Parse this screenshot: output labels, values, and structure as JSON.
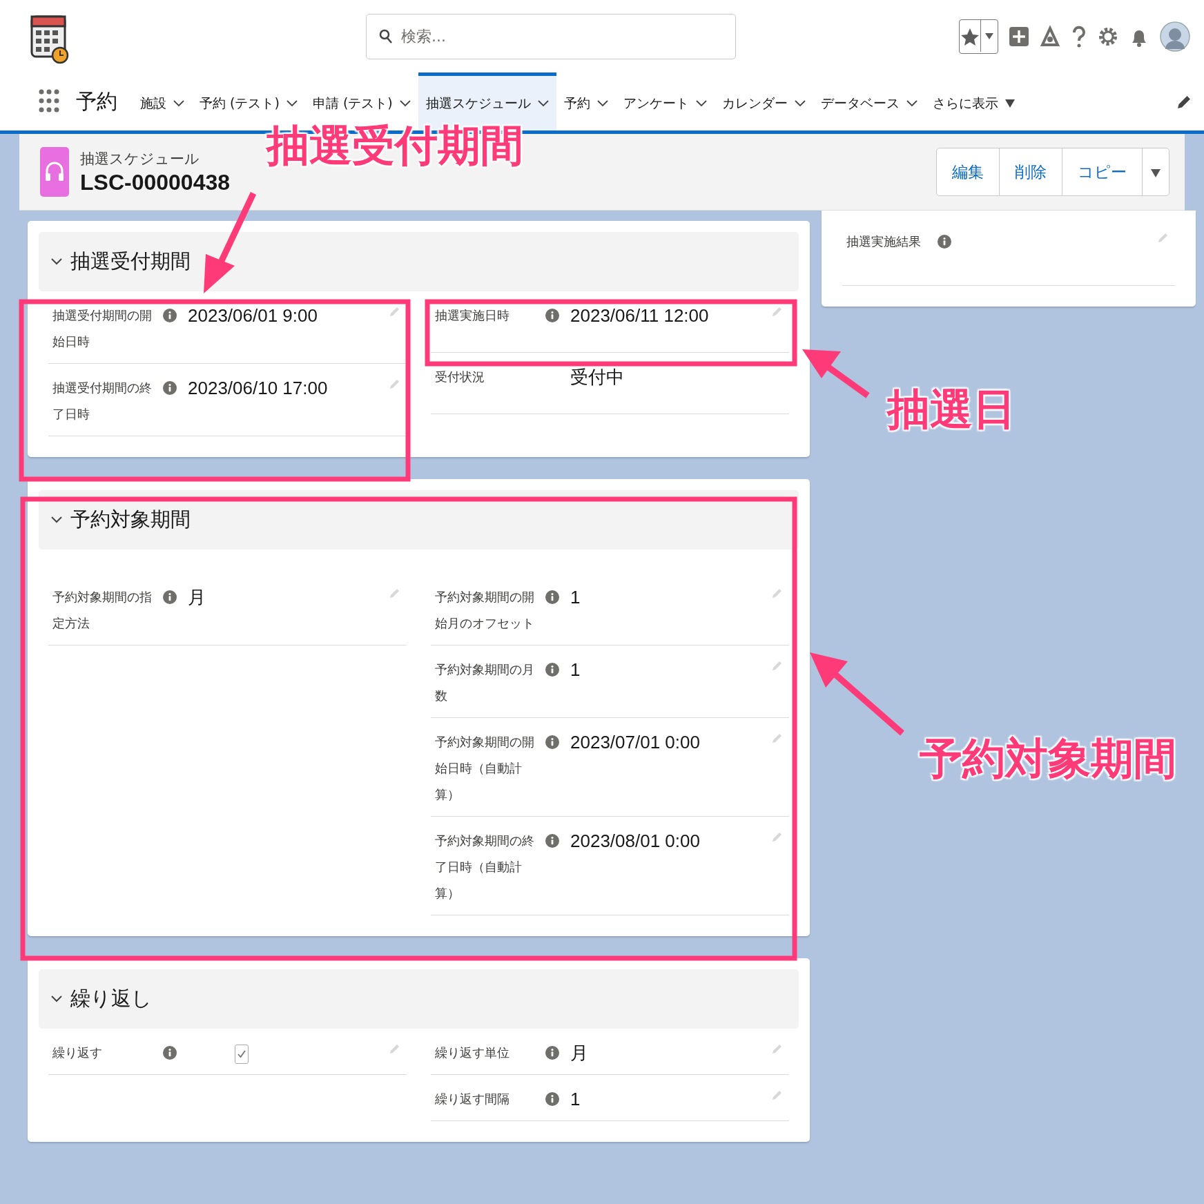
{
  "search": {
    "placeholder": "検索..."
  },
  "app": {
    "name": "予約"
  },
  "nav_tabs": [
    {
      "label": "施設",
      "selected": false,
      "kind": "menu"
    },
    {
      "label": "予約 (テスト)",
      "selected": false,
      "kind": "menu"
    },
    {
      "label": "申請 (テスト)",
      "selected": false,
      "kind": "menu"
    },
    {
      "label": "抽選スケジュール",
      "selected": true,
      "kind": "menu"
    },
    {
      "label": "予約",
      "selected": false,
      "kind": "menu"
    },
    {
      "label": "アンケート",
      "selected": false,
      "kind": "menu"
    },
    {
      "label": "カレンダー",
      "selected": false,
      "kind": "menu"
    },
    {
      "label": "データベース",
      "selected": false,
      "kind": "menu"
    },
    {
      "label": "さらに表示",
      "selected": false,
      "kind": "more"
    }
  ],
  "record": {
    "object_label": "抽選スケジュール",
    "name": "LSC-00000438",
    "actions": [
      "編集",
      "削除",
      "コピー"
    ]
  },
  "sections": [
    {
      "title": "抽選受付期間",
      "expanded": true,
      "left_fields": [
        {
          "label": "抽選受付期間の開始日時",
          "info": true,
          "kind": "text",
          "value": "2023/06/01 9:00",
          "editable": true
        },
        {
          "label": "抽選受付期間の終了日時",
          "info": true,
          "kind": "text",
          "value": "2023/06/10 17:00",
          "editable": true
        }
      ],
      "right_fields": [
        {
          "label": "抽選実施日時",
          "info": true,
          "kind": "text",
          "value": "2023/06/11 12:00",
          "editable": true
        },
        {
          "label": "受付状況",
          "info": false,
          "kind": "text",
          "value": "受付中",
          "editable": false
        }
      ]
    },
    {
      "title": "予約対象期間",
      "expanded": true,
      "left_fields": [
        {
          "label": "予約対象期間の指定方法",
          "info": true,
          "kind": "text",
          "value": "月",
          "editable": true
        }
      ],
      "right_fields": [
        {
          "label": "予約対象期間の開始月のオフセット",
          "info": true,
          "kind": "text",
          "value": "1",
          "editable": true
        },
        {
          "label": "予約対象期間の月数",
          "info": true,
          "kind": "text",
          "value": "1",
          "editable": true
        },
        {
          "label": "予約対象期間の開始日時（自動計算）",
          "info": true,
          "kind": "text",
          "value": "2023/07/01 0:00",
          "editable": true
        },
        {
          "label": "予約対象期間の終了日時（自動計算）",
          "info": true,
          "kind": "text",
          "value": "2023/08/01 0:00",
          "editable": true
        }
      ]
    },
    {
      "title": "繰り返し",
      "expanded": true,
      "left_fields": [
        {
          "label": "繰り返す",
          "info": true,
          "kind": "checkbox",
          "checked": true,
          "editable": true
        }
      ],
      "right_fields": [
        {
          "label": "繰り返す単位",
          "info": true,
          "kind": "text",
          "value": "月",
          "editable": true
        },
        {
          "label": "繰り返す間隔",
          "info": true,
          "kind": "text",
          "value": "1",
          "editable": true
        }
      ]
    }
  ],
  "side_panel": {
    "fields": [
      {
        "label": "抽選実施結果",
        "info": true,
        "editable": true
      }
    ]
  },
  "annotations": [
    {
      "text": "抽選受付期間"
    },
    {
      "text": "抽選日"
    },
    {
      "text": "予約対象期間"
    }
  ]
}
